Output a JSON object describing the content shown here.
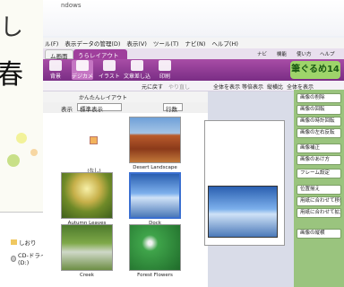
{
  "card": {
    "kanji_top": "し",
    "kanji_main": "春"
  },
  "explorer": {
    "items": [
      {
        "icon": "folder-icon",
        "label": "しおり"
      },
      {
        "icon": "drive-icon",
        "label": "CD-ドライブ (D:)"
      }
    ]
  },
  "window": {
    "title_suffix": "ndows",
    "menu": [
      "ル(F)",
      "表示データの管理(D)",
      "表示(V)",
      "ツール(T)",
      "ナビ(N)",
      "ヘルプ(H)"
    ],
    "tabs": {
      "home": "ム画面",
      "layout": "うらレイアウト"
    },
    "tab_right": [
      "ナビ",
      "機能",
      "使い方",
      "ヘルプ"
    ],
    "ribbon": [
      "背景",
      "デジカメ",
      "イラスト",
      "文章差し込み",
      "印刷"
    ],
    "logo": "筆ぐるめ14",
    "toolbar2": [
      "元に戻す",
      "やり直し",
      "全体を表示",
      "等倍表示",
      "縦横比",
      "全体を表示"
    ],
    "toolbar3": [
      "かんたんレイアウト"
    ],
    "filter": {
      "label": "表示",
      "value": "標準表示",
      "sort": "行数"
    }
  },
  "thumbs": [
    {
      "caption": "(なし)",
      "img": "none"
    },
    {
      "caption": "Desert Landscape",
      "img": "desert"
    },
    {
      "caption": "Autumn Leaves",
      "img": "autumn"
    },
    {
      "caption": "Dock",
      "img": "dock"
    },
    {
      "caption": "Creek",
      "img": "creek"
    },
    {
      "caption": "Forest Flowers",
      "img": "flowers"
    }
  ],
  "right_panel": {
    "buttons": [
      "画像の削除",
      "画像の回転",
      "画像の時計回転",
      "画像の左右反転",
      "画像補正",
      "画像のあけ方",
      "フレーム設定",
      "位置揃え",
      "用紙に合わせて移動",
      "用紙に合わせて拡大",
      "画像の縦横"
    ]
  }
}
